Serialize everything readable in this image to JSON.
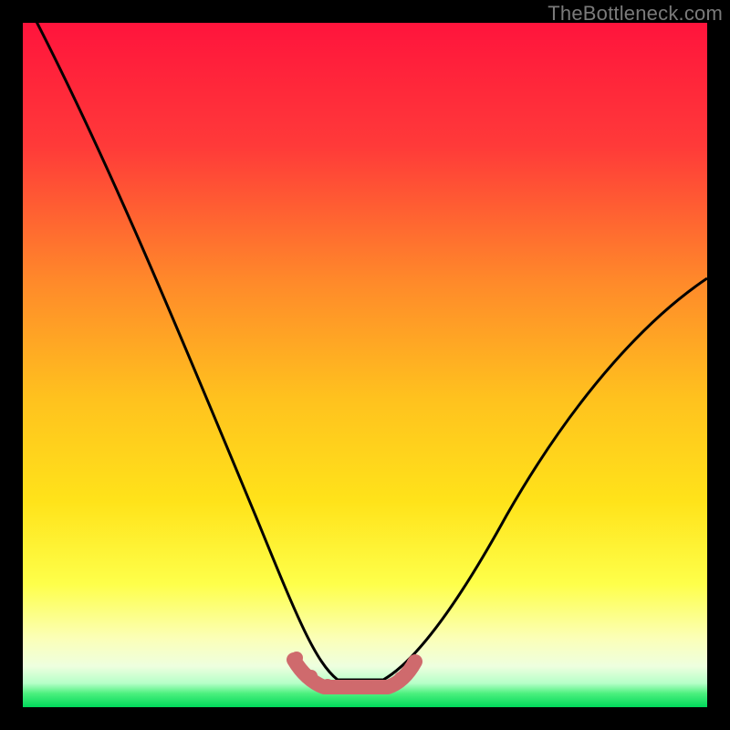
{
  "watermark": "TheBottleneck.com",
  "colors": {
    "frame": "#000000",
    "gradient_top": "#ff143c",
    "gradient_mid_upper": "#ff6a2a",
    "gradient_mid": "#ffd400",
    "gradient_mid_lower": "#f8ff66",
    "gradient_pale": "#fdffd0",
    "gradient_green": "#00e060",
    "curve_stroke": "#000000",
    "flat_segment": "#cf6a6d"
  },
  "chart_data": {
    "type": "line",
    "title": "",
    "xlabel": "",
    "ylabel": "",
    "xlim": [
      0,
      100
    ],
    "ylim": [
      0,
      100
    ],
    "series": [
      {
        "name": "bottleneck-curve",
        "x": [
          0,
          3,
          6,
          9,
          12,
          15,
          18,
          21,
          24,
          27,
          30,
          33,
          35,
          37,
          39,
          41,
          43,
          45,
          47,
          49,
          52,
          56,
          60,
          65,
          70,
          76,
          82,
          88,
          94,
          100
        ],
        "y": [
          104,
          98,
          92,
          86,
          80,
          73,
          66,
          59,
          52,
          45,
          38,
          31,
          26,
          21,
          16,
          11,
          7,
          4,
          2,
          1,
          2,
          5,
          10,
          17,
          24,
          32,
          40,
          48,
          55,
          62
        ]
      },
      {
        "name": "optimal-flat-segment",
        "x": [
          37,
          39,
          41,
          43,
          45,
          47,
          49,
          51,
          53
        ],
        "y": [
          5,
          3,
          2,
          1,
          1,
          1,
          1,
          2,
          4
        ]
      }
    ],
    "optimal_range_x": [
      39,
      52
    ],
    "annotations": []
  }
}
